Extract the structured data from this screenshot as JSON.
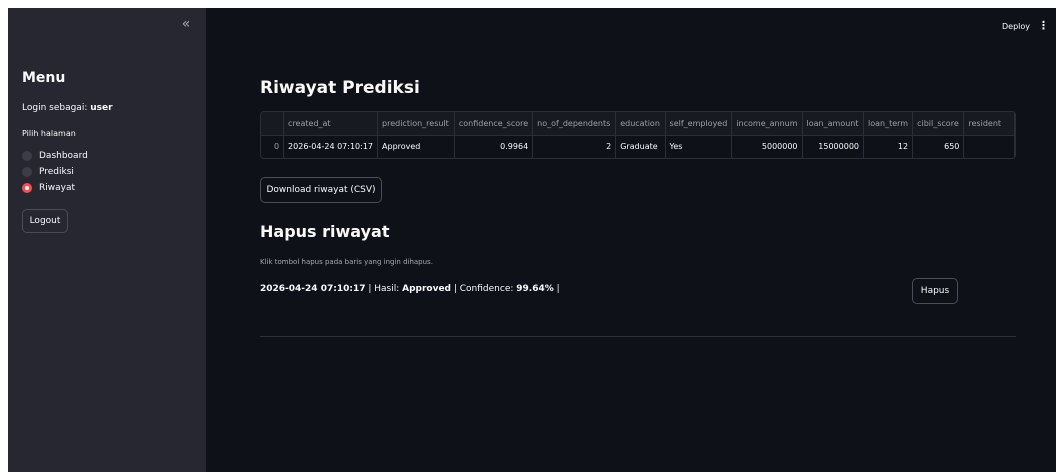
{
  "sidebar": {
    "collapse_icon": "«",
    "menu_title": "Menu",
    "login_prefix": "Login sebagai:",
    "login_user": "user",
    "page_label": "Pilih halaman",
    "options": [
      {
        "label": "Dashboard",
        "selected": false
      },
      {
        "label": "Prediksi",
        "selected": false
      },
      {
        "label": "Riwayat",
        "selected": true
      }
    ],
    "logout_label": "Logout"
  },
  "topbar": {
    "deploy_label": "Deploy",
    "menu_icon": "⋮"
  },
  "main": {
    "title": "Riwayat Prediksi",
    "table": {
      "columns": [
        "",
        "created_at",
        "prediction_result",
        "confidence_score",
        "no_of_dependents",
        "education",
        "self_employed",
        "income_annum",
        "loan_amount",
        "loan_term",
        "cibil_score",
        "resident"
      ],
      "rows": [
        [
          "0",
          "2026-04-24 07:10:17",
          "Approved",
          "0.9964",
          "2",
          "Graduate",
          "Yes",
          "5000000",
          "15000000",
          "12",
          "650",
          ""
        ]
      ]
    },
    "download_label": "Download riwayat (CSV)",
    "delete_section": {
      "title": "Hapus riwayat",
      "caption": "Klik tombol hapus pada baris yang ingin dihapus.",
      "record": {
        "timestamp": "2026-04-24 07:10:17",
        "sep1": " | Hasil: ",
        "result": "Approved",
        "sep2": " | Confidence: ",
        "confidence": "99.64%",
        "sep3": " |"
      },
      "delete_label": "Hapus"
    }
  },
  "colors": {
    "background": "#0e1117",
    "sidebar": "#262730",
    "accent": "#ff4b4b"
  }
}
